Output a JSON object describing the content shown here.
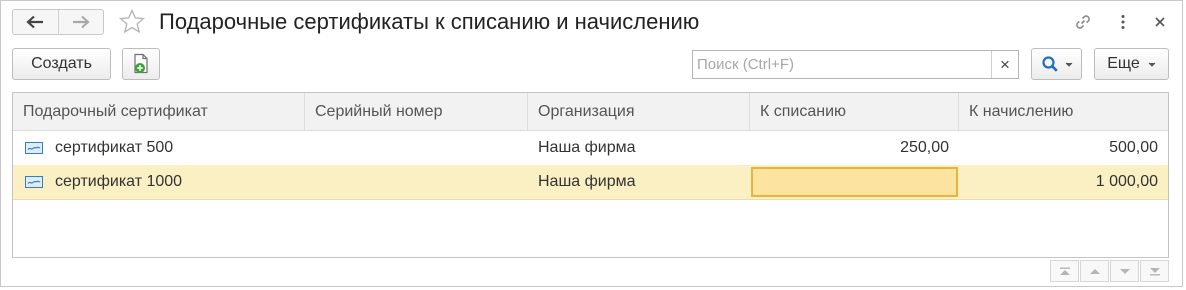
{
  "window": {
    "title": "Подарочные сертификаты к списанию и начислению"
  },
  "toolbar": {
    "create_label": "Создать",
    "search_placeholder": "Поиск (Ctrl+F)",
    "search_value": "",
    "clear_label": "×",
    "more_label": "Еще"
  },
  "table": {
    "columns": [
      "Подарочный сертификат",
      "Серийный номер",
      "Организация",
      "К списанию",
      "К начислению"
    ],
    "rows": [
      {
        "certificate": "сертификат 500",
        "serial": "",
        "organization": "Наша фирма",
        "to_write_off": "250,00",
        "to_accrue": "500,00"
      },
      {
        "certificate": "сертификат 1000",
        "serial": "",
        "organization": "Наша фирма",
        "to_write_off": "",
        "to_accrue": "1 000,00"
      }
    ]
  },
  "colors": {
    "selected_row": "#fbefc4",
    "active_cell": "#fde3a0",
    "active_cell_border": "#e7b53b",
    "accent_blue": "#1f6fbf",
    "add_icon_green": "#3aa43a"
  },
  "icons": [
    "back-arrow-icon",
    "forward-arrow-icon",
    "star-icon",
    "link-icon",
    "more-vertical-icon",
    "close-icon",
    "add-copy-icon",
    "search-icon",
    "dropdown-icon",
    "certificate-icon",
    "scroll-top-icon",
    "scroll-up-icon",
    "scroll-down-icon",
    "scroll-bottom-icon"
  ]
}
